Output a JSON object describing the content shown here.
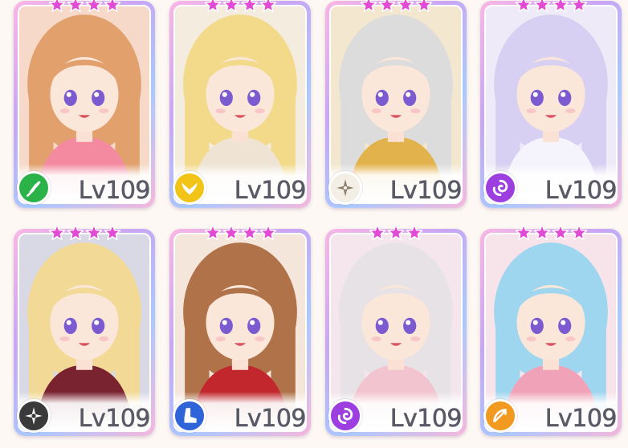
{
  "cards": [
    {
      "stars": 4,
      "level": "Lv109",
      "element": "wind-icon",
      "element_color": "#2bb34a",
      "hair": "#e2a06d",
      "bg": "#f6d9c9",
      "outfit": "#f48aa0"
    },
    {
      "stars": 4,
      "level": "Lv109",
      "element": "light-wing-icon",
      "element_color": "#f2c417",
      "hair": "#f3d98a",
      "bg": "#f4ecde",
      "outfit": "#efe4d4"
    },
    {
      "stars": 4,
      "level": "Lv109",
      "element": "compass-icon",
      "element_color": "#f3efe6",
      "hair": "#dcdcdc",
      "bg": "#f3e7cf",
      "outfit": "#e2b34c"
    },
    {
      "stars": 4,
      "level": "Lv109",
      "element": "vortex-icon",
      "element_color": "#9c3ee0",
      "hair": "#d7d0f2",
      "bg": "#eeeaf8",
      "outfit": "#f5f3fb"
    },
    {
      "stars": 4,
      "level": "Lv109",
      "element": "shuriken-icon",
      "element_color": "#3a3a3a",
      "hair": "#f2da96",
      "bg": "#d9d9e6",
      "outfit": "#7a2330"
    },
    {
      "stars": 4,
      "level": "Lv109",
      "element": "boot-icon",
      "element_color": "#2f63d8",
      "hair": "#b07248",
      "bg": "#f4e6da",
      "outfit": "#c1272d"
    },
    {
      "stars": 3,
      "level": "Lv109",
      "element": "vortex-icon",
      "element_color": "#9c3ee0",
      "hair": "#e6e2e6",
      "bg": "#f5e6ee",
      "outfit": "#f2c4cf"
    },
    {
      "stars": 4,
      "level": "Lv109",
      "element": "bow-icon",
      "element_color": "#f29a1f",
      "hair": "#9fd6ef",
      "bg": "#f7e3ea",
      "outfit": "#f0a3b8"
    }
  ],
  "colors": {
    "star": "#e24bd4",
    "star_stroke": "#ffffff",
    "level_text": "#5a5a66"
  }
}
